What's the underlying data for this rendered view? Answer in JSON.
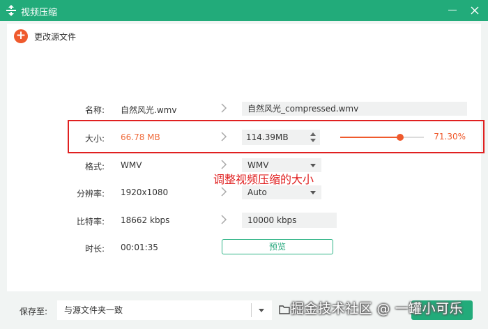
{
  "window": {
    "title": "视频压缩"
  },
  "toolbar": {
    "change_source_label": "更改源文件"
  },
  "fields": {
    "name": {
      "label": "名称:",
      "source": "自然风光.wmv",
      "target": "自然风光_compressed.wmv"
    },
    "size": {
      "label": "大小:",
      "source": "66.78 MB",
      "target": "114.39MB",
      "percent_text": "71.30%",
      "slider_fraction": 0.713
    },
    "format": {
      "label": "格式:",
      "source": "WMV",
      "target": "WMV"
    },
    "resolution": {
      "label": "分辨率:",
      "source": "1920x1080",
      "target": "Auto"
    },
    "bitrate": {
      "label": "比特率:",
      "source": "18662 kbps",
      "target": "10000 kbps"
    },
    "duration": {
      "label": "时长:",
      "source": "00:01:35"
    }
  },
  "preview_button_label": "预览",
  "annotation_text": "调整视频压缩的大小",
  "save": {
    "label": "保存至:",
    "value": "与源文件夹一致"
  },
  "watermark_text": "掘金技术社区 @ 一罐小可乐",
  "colors": {
    "brand_green": "#22ab7a",
    "accent_orange": "#ef5a2d",
    "highlight_red": "#e02020"
  },
  "icons": {
    "app": "compress-app-icon",
    "add": "plus-icon",
    "arrow": "chevron-right-icon",
    "folder": "folder-icon",
    "close": "close-icon"
  }
}
